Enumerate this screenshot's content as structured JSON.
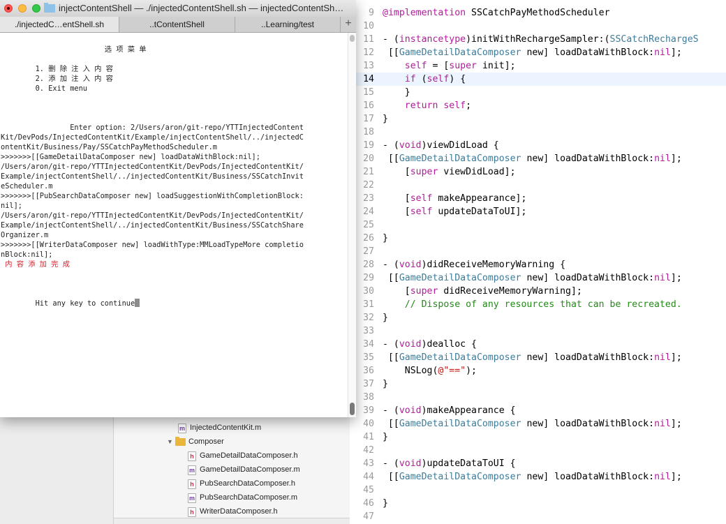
{
  "terminal": {
    "title": "injectContentShell — ./injectedContentShell.sh — injectedContentSh…",
    "tabs": [
      {
        "label": "./injectedC…entShell.sh",
        "active": true
      },
      {
        "label": "..tContentShell",
        "active": false
      },
      {
        "label": "..Learning/test",
        "active": false
      }
    ],
    "add_tab_glyph": "+",
    "lines": [
      {
        "text": "                        选 项 菜 单",
        "color": "default"
      },
      {
        "text": "",
        "color": "default"
      },
      {
        "text": "        1. 删 除 注 入 内 容",
        "color": "default"
      },
      {
        "text": "        2. 添 加 注 入 内 容",
        "color": "default"
      },
      {
        "text": "        0. Exit menu",
        "color": "default"
      },
      {
        "text": "",
        "color": "default"
      },
      {
        "text": "",
        "color": "default"
      },
      {
        "text": "",
        "color": "default"
      },
      {
        "text": "                Enter option: 2/Users/aron/git-repo/YTTInjectedContent",
        "color": "default"
      },
      {
        "text": "Kit/DevPods/InjectedContentKit/Example/injectContentShell/../injectedC",
        "color": "default"
      },
      {
        "text": "ontentKit/Business/Pay/SSCatchPayMethodScheduler.m",
        "color": "default"
      },
      {
        "text": ">>>>>>>[[GameDetailDataComposer new] loadDataWithBlock:nil];",
        "color": "default"
      },
      {
        "text": "/Users/aron/git-repo/YTTInjectedContentKit/DevPods/InjectedContentKit/",
        "color": "default"
      },
      {
        "text": "Example/injectContentShell/../injectedContentKit/Business/SSCatchInvit",
        "color": "default"
      },
      {
        "text": "eScheduler.m",
        "color": "default"
      },
      {
        "text": ">>>>>>>[[PubSearchDataComposer new] loadSuggestionWithCompletionBlock:",
        "color": "default"
      },
      {
        "text": "nil];",
        "color": "default"
      },
      {
        "text": "/Users/aron/git-repo/YTTInjectedContentKit/DevPods/InjectedContentKit/",
        "color": "default"
      },
      {
        "text": "Example/injectContentShell/../injectedContentKit/Business/SSCatchShare",
        "color": "default"
      },
      {
        "text": "Organizer.m",
        "color": "default"
      },
      {
        "text": ">>>>>>>[[WriterDataComposer new] loadWithType:MMLoadTypeMore completio",
        "color": "default"
      },
      {
        "text": "nBlock:nil];",
        "color": "default"
      },
      {
        "text": " 内 容 添 加 完 成",
        "color": "red"
      },
      {
        "text": "",
        "color": "default"
      },
      {
        "text": "",
        "color": "default"
      },
      {
        "text": "",
        "color": "default"
      },
      {
        "text": "        Hit any key to continue",
        "color": "default",
        "cursor": true
      }
    ],
    "colors": {
      "text": "#1f1f1f",
      "red": "#d3212c"
    }
  },
  "navigator": {
    "items": [
      {
        "label": "InjectedContentKit.m",
        "kind": "m",
        "level": 1
      },
      {
        "label": "Composer",
        "kind": "folder",
        "level": 0,
        "expanded": true,
        "disclosure": "▼"
      },
      {
        "label": "GameDetailDataComposer.h",
        "kind": "h",
        "level": 2
      },
      {
        "label": "GameDetailDataComposer.m",
        "kind": "m",
        "level": 2
      },
      {
        "label": "PubSearchDataComposer.h",
        "kind": "h",
        "level": 2
      },
      {
        "label": "PubSearchDataComposer.m",
        "kind": "m",
        "level": 2
      },
      {
        "label": "WriterDataComposer.h",
        "kind": "h",
        "level": 2
      }
    ],
    "icon_letters": {
      "m": "m",
      "h": "h"
    }
  },
  "editor": {
    "current_line": "14",
    "lines": [
      {
        "num": "9",
        "tokens": [
          [
            "kw",
            "@implementation"
          ],
          [
            "",
            " SSCatchPayMethodScheduler"
          ]
        ]
      },
      {
        "num": "10",
        "tokens": []
      },
      {
        "num": "11",
        "tokens": [
          [
            "",
            "- ("
          ],
          [
            "kw",
            "instancetype"
          ],
          [
            "",
            ")initWithRechargeSampler:("
          ],
          [
            "cls",
            "SSCatchRechargeS"
          ]
        ]
      },
      {
        "num": "12",
        "tokens": [
          [
            "",
            " [["
          ],
          [
            "cls",
            "GameDetailDataComposer"
          ],
          [
            "",
            " new] loadDataWithBlock:"
          ],
          [
            "kw",
            "nil"
          ],
          [
            "",
            "];"
          ]
        ]
      },
      {
        "num": "13",
        "tokens": [
          [
            "",
            "    "
          ],
          [
            "kw",
            "self"
          ],
          [
            "",
            " = ["
          ],
          [
            "kw",
            "super"
          ],
          [
            "",
            " init];"
          ]
        ]
      },
      {
        "num": "14",
        "tokens": [
          [
            "",
            "    "
          ],
          [
            "kw",
            "if"
          ],
          [
            "",
            " ("
          ],
          [
            "kw",
            "self"
          ],
          [
            "",
            ") {"
          ]
        ]
      },
      {
        "num": "15",
        "tokens": [
          [
            "",
            "    }"
          ]
        ]
      },
      {
        "num": "16",
        "tokens": [
          [
            "",
            "    "
          ],
          [
            "kw",
            "return"
          ],
          [
            "",
            " "
          ],
          [
            "kw",
            "self"
          ],
          [
            "",
            ";"
          ]
        ]
      },
      {
        "num": "17",
        "tokens": [
          [
            "",
            "}"
          ]
        ]
      },
      {
        "num": "18",
        "tokens": []
      },
      {
        "num": "19",
        "tokens": [
          [
            "",
            "- ("
          ],
          [
            "kw",
            "void"
          ],
          [
            "",
            ")viewDidLoad {"
          ]
        ]
      },
      {
        "num": "20",
        "tokens": [
          [
            "",
            " [["
          ],
          [
            "cls",
            "GameDetailDataComposer"
          ],
          [
            "",
            " new] loadDataWithBlock:"
          ],
          [
            "kw",
            "nil"
          ],
          [
            "",
            "];"
          ]
        ]
      },
      {
        "num": "21",
        "tokens": [
          [
            "",
            "    ["
          ],
          [
            "kw",
            "super"
          ],
          [
            "",
            " viewDidLoad];"
          ]
        ]
      },
      {
        "num": "22",
        "tokens": []
      },
      {
        "num": "23",
        "tokens": [
          [
            "",
            "    ["
          ],
          [
            "kw",
            "self"
          ],
          [
            "",
            " makeAppearance];"
          ]
        ]
      },
      {
        "num": "24",
        "tokens": [
          [
            "",
            "    ["
          ],
          [
            "kw",
            "self"
          ],
          [
            "",
            " updateDataToUI];"
          ]
        ]
      },
      {
        "num": "25",
        "tokens": []
      },
      {
        "num": "26",
        "tokens": [
          [
            "",
            "}"
          ]
        ]
      },
      {
        "num": "27",
        "tokens": []
      },
      {
        "num": "28",
        "tokens": [
          [
            "",
            "- ("
          ],
          [
            "kw",
            "void"
          ],
          [
            "",
            ")didReceiveMemoryWarning {"
          ]
        ]
      },
      {
        "num": "29",
        "tokens": [
          [
            "",
            " [["
          ],
          [
            "cls",
            "GameDetailDataComposer"
          ],
          [
            "",
            " new] loadDataWithBlock:"
          ],
          [
            "kw",
            "nil"
          ],
          [
            "",
            "];"
          ]
        ]
      },
      {
        "num": "30",
        "tokens": [
          [
            "",
            "    ["
          ],
          [
            "kw",
            "super"
          ],
          [
            "",
            " didReceiveMemoryWarning];"
          ]
        ]
      },
      {
        "num": "31",
        "tokens": [
          [
            "",
            "    "
          ],
          [
            "cm",
            "// Dispose of any resources that can be recreated."
          ]
        ]
      },
      {
        "num": "32",
        "tokens": [
          [
            "",
            "}"
          ]
        ]
      },
      {
        "num": "33",
        "tokens": []
      },
      {
        "num": "34",
        "tokens": [
          [
            "",
            "- ("
          ],
          [
            "kw",
            "void"
          ],
          [
            "",
            ")dealloc {"
          ]
        ]
      },
      {
        "num": "35",
        "tokens": [
          [
            "",
            " [["
          ],
          [
            "cls",
            "GameDetailDataComposer"
          ],
          [
            "",
            " new] loadDataWithBlock:"
          ],
          [
            "kw",
            "nil"
          ],
          [
            "",
            "];"
          ]
        ]
      },
      {
        "num": "36",
        "tokens": [
          [
            "",
            "    NSLog("
          ],
          [
            "str",
            "@\"==\""
          ],
          [
            "",
            ");"
          ]
        ]
      },
      {
        "num": "37",
        "tokens": [
          [
            "",
            "}"
          ]
        ]
      },
      {
        "num": "38",
        "tokens": []
      },
      {
        "num": "39",
        "tokens": [
          [
            "",
            "- ("
          ],
          [
            "kw",
            "void"
          ],
          [
            "",
            ")makeAppearance {"
          ]
        ]
      },
      {
        "num": "40",
        "tokens": [
          [
            "",
            " [["
          ],
          [
            "cls",
            "GameDetailDataComposer"
          ],
          [
            "",
            " new] loadDataWithBlock:"
          ],
          [
            "kw",
            "nil"
          ],
          [
            "",
            "];"
          ]
        ]
      },
      {
        "num": "41",
        "tokens": [
          [
            "",
            "}"
          ]
        ]
      },
      {
        "num": "42",
        "tokens": []
      },
      {
        "num": "43",
        "tokens": [
          [
            "",
            "- ("
          ],
          [
            "kw",
            "void"
          ],
          [
            "",
            ")updateDataToUI {"
          ]
        ]
      },
      {
        "num": "44",
        "tokens": [
          [
            "",
            " [["
          ],
          [
            "cls",
            "GameDetailDataComposer"
          ],
          [
            "",
            " new] loadDataWithBlock:"
          ],
          [
            "kw",
            "nil"
          ],
          [
            "",
            "];"
          ]
        ]
      },
      {
        "num": "45",
        "tokens": []
      },
      {
        "num": "46",
        "tokens": [
          [
            "",
            "}"
          ]
        ]
      },
      {
        "num": "47",
        "tokens": []
      }
    ]
  }
}
